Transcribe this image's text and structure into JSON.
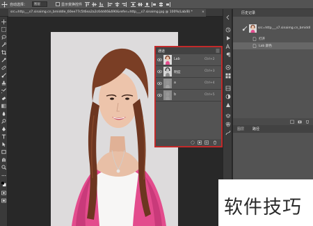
{
  "options_bar": {
    "auto_select_label": "自动选择：",
    "group_value": "图层",
    "show_transform_label": "显示变换控件"
  },
  "document_tab": {
    "title": "src=http___s7.sinaimg.cn_bmiddle_60ee77c5t6ea2a2c6dd46&690&refer=http___s7.sinaimg.jpg @ 100%(Lab/8) *",
    "close": "×"
  },
  "channels_panel": {
    "title": "通道",
    "rows": [
      {
        "name": "Lab",
        "key": "Ctrl+2"
      },
      {
        "name": "明度",
        "key": "Ctrl+3"
      },
      {
        "name": "a",
        "key": "Ctrl+4"
      },
      {
        "name": "b",
        "key": "Ctrl+5"
      }
    ]
  },
  "history_panel": {
    "tab": "历史记录",
    "source": "src=http___s7.sinaimg.cn_bmiddl",
    "items": [
      {
        "label": "打开",
        "active": false
      },
      {
        "label": "Lab 颜色",
        "active": true
      }
    ]
  },
  "layers_panel": {
    "tabs": [
      "图层",
      "路径"
    ]
  },
  "watermark": {
    "text": "软件技巧"
  },
  "colors": {
    "highlight_border": "#c22a2a",
    "panel_bg": "#535353",
    "canvas_bg": "#282828"
  }
}
